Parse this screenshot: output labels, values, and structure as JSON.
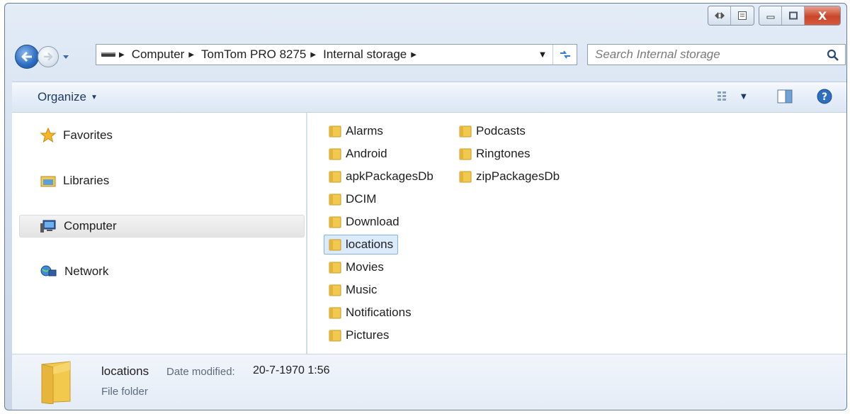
{
  "title_bar": {
    "close_label": "X"
  },
  "address": {
    "crumbs": [
      "Computer",
      "TomTom PRO 8275",
      "Internal storage"
    ]
  },
  "search": {
    "placeholder": "Search Internal storage"
  },
  "command_bar": {
    "organize_label": "Organize"
  },
  "nav_pane": {
    "items": [
      {
        "label": "Favorites",
        "icon": "star-icon"
      },
      {
        "label": "Libraries",
        "icon": "libraries-icon"
      },
      {
        "label": "Computer",
        "icon": "computer-icon"
      },
      {
        "label": "Network",
        "icon": "network-icon"
      }
    ],
    "selected": "Computer"
  },
  "folders": {
    "column1": [
      "Alarms",
      "Android",
      "apkPackagesDb",
      "DCIM",
      "Download",
      "locations",
      "Movies",
      "Music",
      "Notifications",
      "Pictures"
    ],
    "column2": [
      "Podcasts",
      "Ringtones",
      "zipPackagesDb"
    ],
    "selected": "locations"
  },
  "details": {
    "name": "locations",
    "date_label": "Date modified:",
    "date_value": "20-7-1970 1:56",
    "type": "File folder"
  },
  "colors": {
    "selection_bg": "#dcebfc",
    "selection_border": "#7eb4ea",
    "folder_yellow": "#f2c94c",
    "close_red": "#c9452a"
  }
}
